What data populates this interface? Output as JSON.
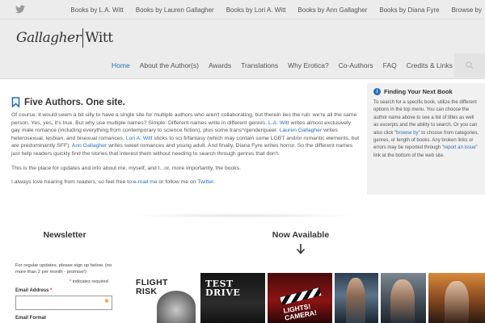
{
  "topbar": {
    "social_icon": "twitter-bird-icon",
    "links": [
      "Books by L.A. Witt",
      "Books by Lauren Gallagher",
      "Books by Lori A. Witt",
      "Books by Ann Gallagher",
      "Books by Diana Fyre",
      "Browse by"
    ]
  },
  "logo": {
    "part1": "Gallagher",
    "part2": "Witt"
  },
  "nav": {
    "items": [
      "Home",
      "About the Author(s)",
      "Awards",
      "Translations",
      "Why Erotica?",
      "Co-Authors",
      "FAQ",
      "Credits & Links"
    ],
    "active_index": 0,
    "search_icon": "search-icon"
  },
  "main": {
    "title": "Five Authors. One site.",
    "p1": {
      "t1": "Of course, it would seem a bit silly to have a single site for multiple authors who aren't collaborating, but therein lies the rub: we're all the same person.  Yes, yes, it's true.   But why use multiple names?  Simple: Different names write in different genres.  ",
      "link1": "L.A. Witt",
      "t2": " writes almost exclusively gay male romance (including everything from contemporary to science fiction), plus some trans*/genderqueer. ",
      "link2": "Lauren Gallagher",
      "t3": " writes heterosexual, lesbian, and bisexual romances. ",
      "link3": "Lori A. Witt",
      "t4": " sticks to sci fi/fantasy (which may contain some LGBT and/or romantic elements, but are predominantly SFF). ",
      "link4": "Ann Gallagher",
      "t5": " writes sweet romances and young adult. And finally, Diana Fyre writes horror. So the different names just help readers quickly find the stories that interest them without needing to search through genres that don't."
    },
    "p2": "This is the place for updates and info about me, myself, and I...or, more importantly, the books.",
    "p3": {
      "t1": "I always love hearing from readers, so feel free to ",
      "link1": "e-mail me",
      "t2": " or follow me on ",
      "link2": "Twitter",
      "t3": "."
    }
  },
  "sidebar": {
    "title": "Finding Your Next Book",
    "t1": "To search for a specific book, utilize the different options in the top menu.  You can choose the author name above to see a list of titles as well as excerpts and the ability to search.   Or you can also click \"",
    "link1": "browse by",
    "t2": "\" to choose from categories, genres, or length of books.  Any broken links or errors may be reported through \"",
    "link2": "report an issue",
    "t3": "\" link at the bottom of the web site."
  },
  "newsletter": {
    "heading": "Newsletter",
    "intro": "For regular updates, please sign up below. (no more than 2 per month - promise!)",
    "required_mark": "*",
    "required_text": " indicates required",
    "email_label": "Email Address ",
    "format_label": "Email Format"
  },
  "available": {
    "heading": "Now Available",
    "arrow_icon": "arrow-down-icon",
    "covers": [
      {
        "text": "FLIGHT RISK"
      },
      {
        "text": "TEST DRIVE"
      },
      {
        "text": "LIGHTS! CAMERA!"
      },
      {
        "text": ""
      },
      {
        "text": ""
      },
      {
        "text": ""
      }
    ]
  },
  "colors": {
    "accent": "#2a6fb8",
    "header_bg": "#ececec",
    "sidebar_bg": "#f1f1f1"
  }
}
